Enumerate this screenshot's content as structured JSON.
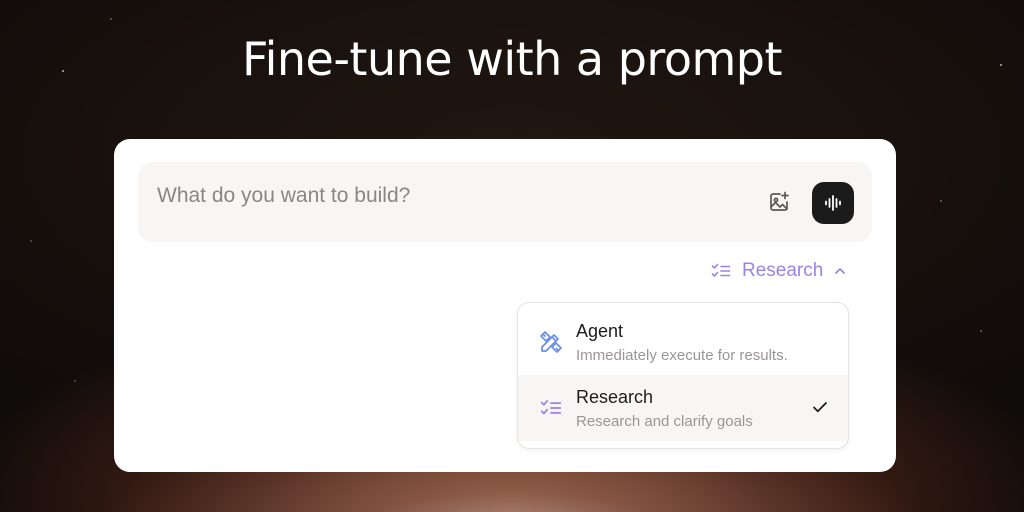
{
  "hero": {
    "title": "Fine-tune with a prompt"
  },
  "prompt": {
    "placeholder": "What do you want to build?",
    "value": "",
    "image_button_icon": "image-add-icon",
    "voice_button_icon": "waveform-icon"
  },
  "mode_selector": {
    "selected_label": "Research",
    "icon": "checklist-icon",
    "caret_icon": "chevron-up-icon",
    "accent_color": "#9a83e3"
  },
  "mode_menu": {
    "options": [
      {
        "title": "Agent",
        "description": "Immediately execute for results.",
        "icon": "pencil-ruler-icon",
        "icon_color": "#6b8ee8",
        "selected": false
      },
      {
        "title": "Research",
        "description": "Research and clarify goals",
        "icon": "checklist-icon",
        "icon_color": "#9a83e3",
        "selected": true
      }
    ]
  },
  "colors": {
    "card_bg": "#ffffff",
    "input_bg": "#f8f6f5",
    "voice_button_bg": "#1c1b1b"
  }
}
